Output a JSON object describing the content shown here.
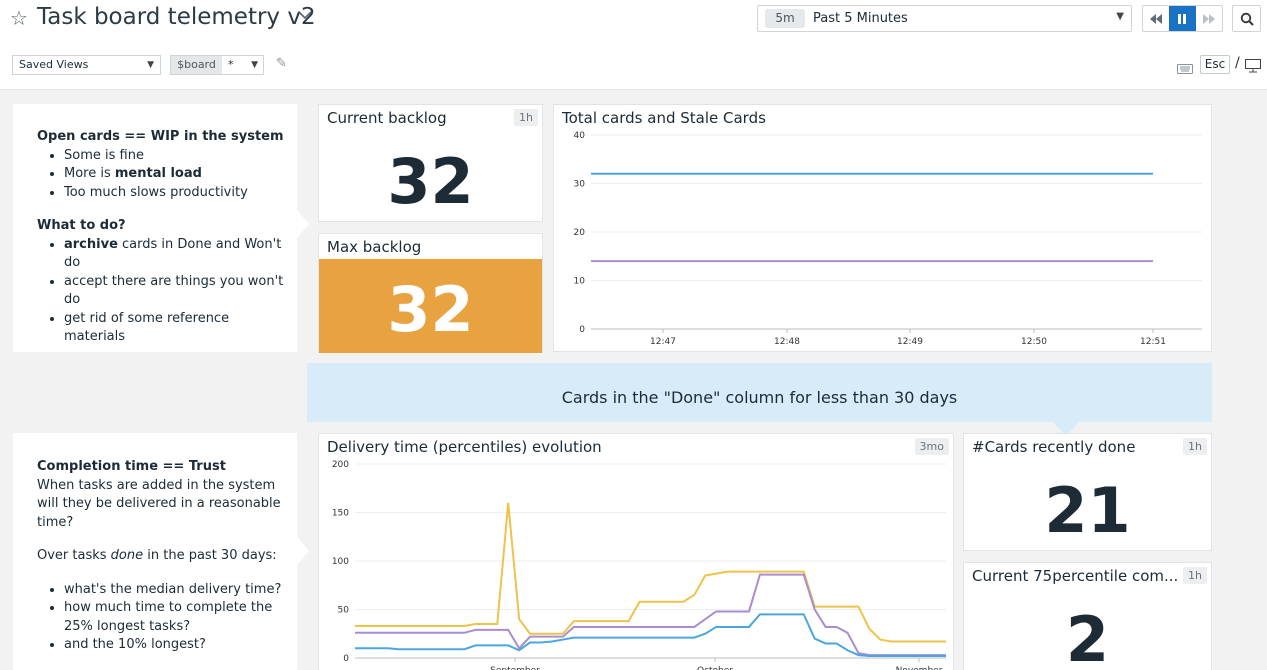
{
  "header": {
    "title": "Task board telemetry v2",
    "time_badge": "5m",
    "time_label": "Past 5 Minutes",
    "saved_views": "Saved Views",
    "var_name": "$board",
    "var_value": "*",
    "esc_key": "Esc",
    "slash": "/"
  },
  "notes": {
    "wip": {
      "heading1": "Open cards == WIP in the system",
      "item1": "Some is fine",
      "item2_prefix": "More is ",
      "item2_bold": "mental load",
      "item3": "Too much slows productivity",
      "heading2": "What to do?",
      "todo1_bold": "archive",
      "todo1_rest": " cards in Done and Won't do",
      "todo2": "accept there are things you won't do",
      "todo3": "get rid of some reference materials"
    },
    "trust": {
      "heading": "Completion time == Trust",
      "para1": "When tasks are added in the system will they be delivered in a reasonable time?",
      "para2_prefix": "Over tasks ",
      "para2_italic": "done",
      "para2_suffix": " in the past 30 days:",
      "q1": "what's the median delivery time?",
      "q2": "how much time to complete the 25% longest tasks?",
      "q3": "and the 10% longest?"
    }
  },
  "widgets": {
    "current_backlog": {
      "title": "Current backlog",
      "badge": "1h",
      "value": "32"
    },
    "max_backlog": {
      "title": "Max backlog",
      "value": "32",
      "color": "#e8a23f"
    },
    "total_cards": {
      "title": "Total cards and Stale Cards"
    },
    "banner": {
      "text": "Cards in the \"Done\" column for less than 30 days"
    },
    "delivery": {
      "title": "Delivery time (percentiles) evolution",
      "badge": "3mo"
    },
    "recently_done": {
      "title": "#Cards recently done",
      "badge": "1h",
      "value": "21"
    },
    "p75": {
      "title": "Current 75percentile com...",
      "badge": "1h",
      "value": "2"
    }
  },
  "chart_data": [
    {
      "type": "line",
      "title": "Total cards and Stale Cards",
      "x": [
        "12:47",
        "12:48",
        "12:49",
        "12:50",
        "12:51"
      ],
      "ylim": [
        0,
        40
      ],
      "yticks": [
        0,
        10,
        20,
        30,
        40
      ],
      "series": [
        {
          "color": "#4aa6df",
          "values": [
            32,
            32,
            32,
            32,
            32
          ]
        },
        {
          "color": "#a88ed0",
          "values": [
            14,
            14,
            14,
            14,
            14
          ]
        }
      ],
      "grid": true
    },
    {
      "type": "line",
      "title": "Delivery time (percentiles) evolution",
      "x_ticks": [
        "September",
        "October",
        "November"
      ],
      "ylim": [
        0,
        200
      ],
      "yticks": [
        0,
        50,
        100,
        150,
        200
      ],
      "series": [
        {
          "color": "#eec34a",
          "values": [
            33,
            33,
            33,
            33,
            33,
            33,
            33,
            33,
            33,
            33,
            33,
            35,
            35,
            35,
            160,
            40,
            25,
            25,
            25,
            25,
            38,
            38,
            38,
            38,
            38,
            38,
            58,
            58,
            58,
            58,
            58,
            65,
            85,
            87,
            89,
            89,
            89,
            89,
            89,
            89,
            89,
            89,
            53,
            53,
            53,
            53,
            53,
            30,
            19,
            17,
            17,
            17,
            17,
            17,
            17
          ]
        },
        {
          "color": "#a88ed0",
          "values": [
            26,
            26,
            26,
            26,
            26,
            26,
            26,
            26,
            26,
            26,
            26,
            29,
            29,
            29,
            29,
            10,
            22,
            22,
            22,
            22,
            32,
            32,
            32,
            32,
            32,
            32,
            32,
            32,
            32,
            32,
            32,
            32,
            40,
            48,
            48,
            48,
            48,
            86,
            86,
            86,
            86,
            86,
            50,
            32,
            32,
            26,
            5,
            3,
            3,
            3,
            3,
            3,
            3,
            3,
            3
          ]
        },
        {
          "color": "#4aa6df",
          "values": [
            10,
            10,
            10,
            10,
            9,
            9,
            9,
            9,
            9,
            9,
            9,
            13,
            13,
            13,
            13,
            8,
            16,
            16,
            17,
            19,
            21,
            21,
            21,
            21,
            21,
            21,
            21,
            21,
            21,
            21,
            21,
            21,
            25,
            32,
            32,
            32,
            32,
            45,
            45,
            45,
            45,
            45,
            20,
            15,
            15,
            8,
            3,
            2,
            2,
            2,
            2,
            2,
            2,
            2,
            2
          ]
        }
      ],
      "grid": true
    }
  ]
}
